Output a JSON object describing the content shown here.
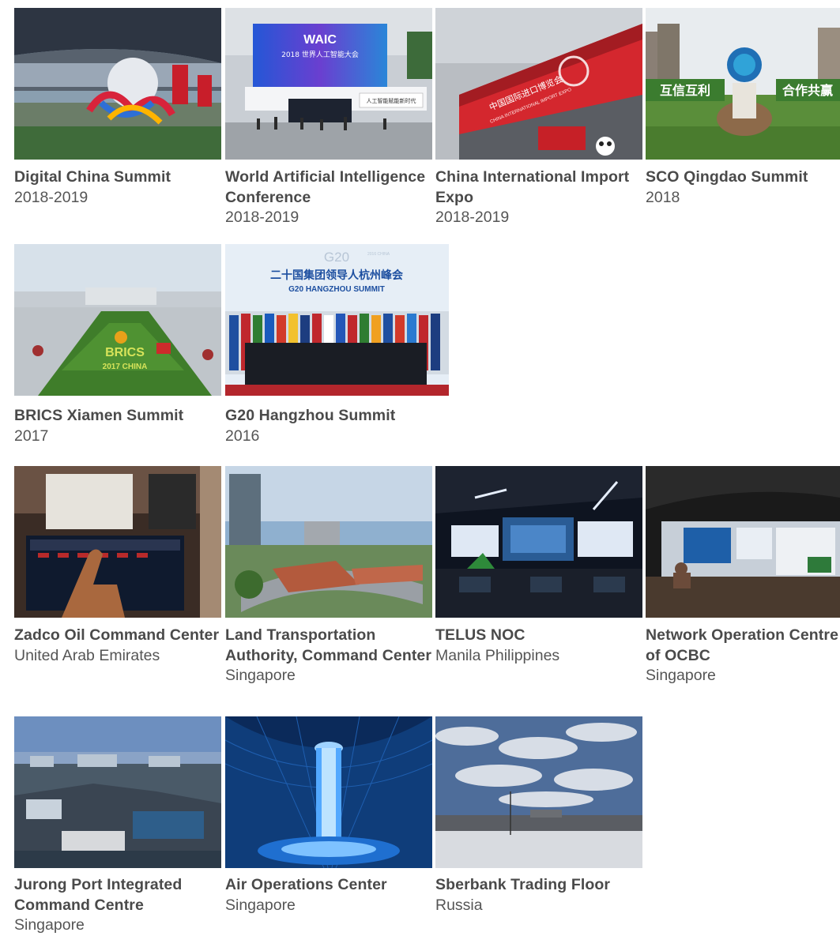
{
  "rows": [
    {
      "items": [
        {
          "title": "Digital China Summit",
          "subtitle": "2018-2019",
          "scene": "digital-china"
        },
        {
          "title": "World Artificial Intelligence Conference",
          "subtitle": "2018-2019",
          "scene": "waic",
          "sign": {
            "brand": "WAIC",
            "name": "2018 世界人工智能大会",
            "tagline": "人工智能赋能新时代"
          }
        },
        {
          "title": "China International Import Expo",
          "subtitle": "2018-2019",
          "scene": "ciie",
          "sign": {
            "name": "中国国际进口博览会",
            "tagline": "CHINA INTERNATIONAL IMPORT EXPO"
          }
        },
        {
          "title": "SCO Qingdao Summit",
          "subtitle": "2018",
          "scene": "sco",
          "sign": {
            "left": "互信互利",
            "right": "合作共赢"
          }
        }
      ]
    },
    {
      "items": [
        {
          "title": "BRICS Xiamen Summit",
          "subtitle": "2017",
          "scene": "brics",
          "sign": {
            "name": "BRICS",
            "tagline": "2017 CHINA"
          }
        },
        {
          "title": "G20 Hangzhou Summit",
          "subtitle": "2016",
          "scene": "g20",
          "sign": {
            "logo": "G20",
            "year": "2016 CHINA",
            "name_cn": "二十国集团领导人杭州峰会",
            "name_en": "G20 HANGZHOU SUMMIT"
          }
        }
      ]
    },
    {
      "items": [
        {
          "title": "Zadco Oil Command Center",
          "subtitle": "United Arab Emirates",
          "scene": "zadco"
        },
        {
          "title": "Land Transportation Authority, Command Center",
          "subtitle": "Singapore",
          "scene": "lta"
        },
        {
          "title": "TELUS NOC",
          "subtitle": "Manila Philippines",
          "scene": "telus"
        },
        {
          "title": "Network Operation Centre of OCBC",
          "subtitle": "Singapore",
          "scene": "ocbc"
        }
      ]
    },
    {
      "items": [
        {
          "title": "Jurong Port Integrated Command Centre",
          "subtitle": "Singapore",
          "scene": "jurong"
        },
        {
          "title": "Air Operations Center",
          "subtitle": "Singapore",
          "scene": "air"
        },
        {
          "title": "Sberbank Trading Floor",
          "subtitle": "Russia",
          "scene": "sberbank"
        }
      ]
    }
  ]
}
